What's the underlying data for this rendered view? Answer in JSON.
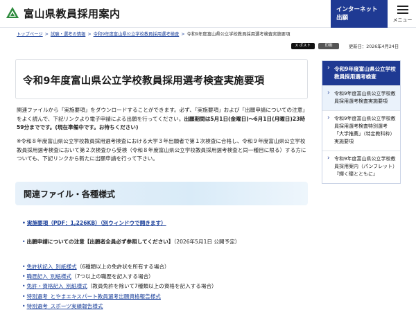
{
  "header": {
    "site_title": "富山県教員採用案内",
    "apply_label_line1": "インターネット",
    "apply_label_line2": "出願",
    "menu_label": "メニュー"
  },
  "breadcrumb": [
    "トップページ",
    "試験・選考の情報",
    "令和9年度富山県公立学校教員採用選考検査",
    "令和9年度富山県公立学校教員採用選考検査実施要項"
  ],
  "share": {
    "x_label": "X ポスト",
    "second_label": "印刷"
  },
  "updated": "更新日：2026年4月24日",
  "page_title": "令和9年度富山県公立学校教員採用選考検査実施要項",
  "intro": {
    "text": "関連ファイルから「実施要項」をダウンロードすることができます。必ず、「実施要項」および「出願申請についての注意」をよく読んで、下記リンクより電子申請による出願を行ってください。",
    "bold": "出願期間は5月1日(金曜日)〜6月1日(月曜日)23時59分までです。(現在準備中です。お待ちください)"
  },
  "note": "※令和８年度富山県公立学校教員採用選考検査における大学３年出願者で第１次検査に合格し、令和９年度富山県公立学校教員採用選考検査において第２次検査から受検（令和８年度富山県公立学校教員採用選考検査と同一種目に限る）する方についても、下記リンクから新たに出願申請を行って下さい。",
  "section_title": "関連ファイル・各種様式",
  "file_link": "実施要項（PDF：1,226KB）（別ウィンドウで開きます）",
  "notice": {
    "bold": "出願申請についての注意【出願者全員必ず参照してください】",
    "suffix": "（2026年5月1日 公開予定）"
  },
  "links": [
    {
      "label": "免許状記入_別紙様式",
      "desc": "（6種類以上の免許状を所有する場合）"
    },
    {
      "label": "職歴記入_別紙様式",
      "desc": "（7つ以上の職歴を記入する場合）"
    },
    {
      "label": "免許・資格記入_別紙様式",
      "desc": "（教員免許を除いて7種類以上の資格を記入する場合）"
    },
    {
      "label": "特別選考_とやまエキスパート教員選考出願資格報告様式",
      "desc": ""
    },
    {
      "label": "特別選考_スポーツ実績報告様式",
      "desc": ""
    }
  ],
  "sidebar": {
    "head": "令和9年度富山県公立学校教員採用選考検査",
    "items": [
      "令和9年度富山県公立学校教員採用選考検査実施要項",
      "令和9年度富山県公立学校教員採用選考検査特別選考「大学推薦」（特定教科枠）実施要項",
      "令和9年度富山県公立学校教員採用案内（パンフレット）『輝く瞳とともに』"
    ]
  }
}
